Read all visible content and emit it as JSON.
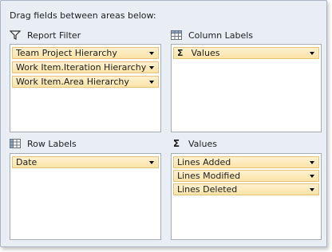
{
  "instruction": "Drag fields between areas below:",
  "areas": {
    "report_filter": {
      "title": "Report Filter",
      "icon": "filter-icon",
      "fields": [
        "Team Project Hierarchy",
        "Work Item.Iteration Hierarchy",
        "Work Item.Area Hierarchy"
      ]
    },
    "column_labels": {
      "title": "Column Labels",
      "icon": "column-labels-icon",
      "fields": [
        "Values"
      ]
    },
    "row_labels": {
      "title": "Row Labels",
      "icon": "row-labels-icon",
      "fields": [
        "Date"
      ]
    },
    "values": {
      "title": "Values",
      "icon": "sigma-icon",
      "fields": [
        "Lines Added",
        "Lines Modified",
        "Lines Deleted"
      ]
    }
  },
  "sigma_glyph": "Σ",
  "colors": {
    "panel_bg": "#e9eef5",
    "field_bg": "#fbe4a8",
    "field_border": "#e6c27a",
    "box_border": "#a5acb5"
  }
}
